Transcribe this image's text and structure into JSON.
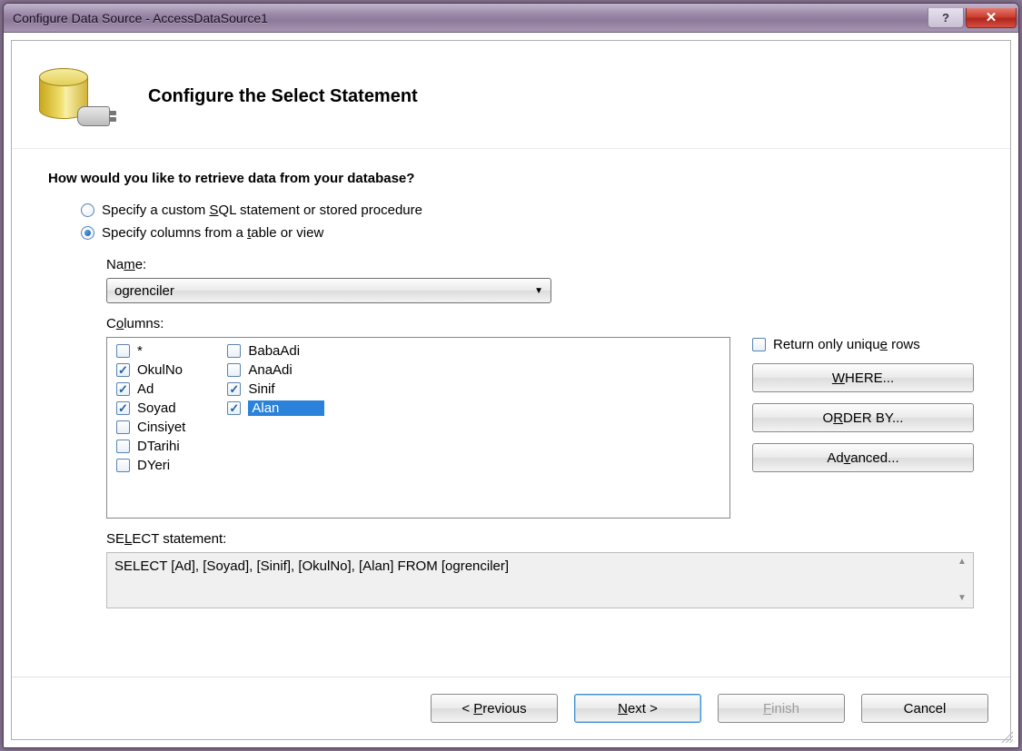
{
  "window": {
    "title": "Configure Data Source - AccessDataSource1"
  },
  "header": {
    "title": "Configure the Select Statement"
  },
  "prompt": "How would you like to retrieve data from your database?",
  "radios": {
    "custom_sql_pre": "Specify a custom ",
    "custom_sql_u": "S",
    "custom_sql_post": "QL statement or stored procedure",
    "columns_pre": "Specify columns from a ",
    "columns_u": "t",
    "columns_post": "able or view"
  },
  "labels": {
    "name_pre": "Na",
    "name_u": "m",
    "name_post": "e:",
    "columns_pre": "C",
    "columns_u": "o",
    "columns_post": "lumns:",
    "select_pre": "SE",
    "select_u": "L",
    "select_post": "ECT statement:",
    "unique_pre": "Return only uniqu",
    "unique_u": "e",
    "unique_post": " rows"
  },
  "name_value": "ogrenciler",
  "columns_left": [
    {
      "label": "*",
      "checked": false
    },
    {
      "label": "OkulNo",
      "checked": true
    },
    {
      "label": "Ad",
      "checked": true
    },
    {
      "label": "Soyad",
      "checked": true
    },
    {
      "label": "Cinsiyet",
      "checked": false
    },
    {
      "label": "DTarihi",
      "checked": false
    },
    {
      "label": "DYeri",
      "checked": false
    }
  ],
  "columns_right": [
    {
      "label": "BabaAdi",
      "checked": false
    },
    {
      "label": "AnaAdi",
      "checked": false
    },
    {
      "label": "Sinif",
      "checked": true
    },
    {
      "label": "Alan",
      "checked": true,
      "selected": true
    }
  ],
  "side_buttons": {
    "where_u": "W",
    "where_post": "HERE...",
    "order_pre": "O",
    "order_u": "R",
    "order_post": "DER BY...",
    "adv_pre": "Ad",
    "adv_u": "v",
    "adv_post": "anced..."
  },
  "select_stmt": "SELECT [Ad], [Soyad], [Sinif], [OkulNo], [Alan] FROM [ogrenciler]",
  "footer": {
    "prev_pre": "< ",
    "prev_u": "P",
    "prev_post": "revious",
    "next_u": "N",
    "next_post": "ext >",
    "finish_u": "F",
    "finish_post": "inish",
    "cancel": "Cancel"
  }
}
